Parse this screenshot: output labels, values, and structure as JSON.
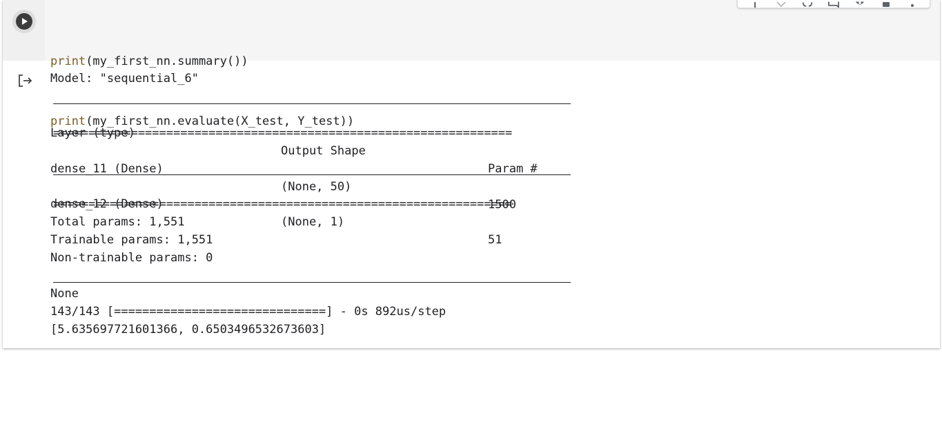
{
  "code": {
    "line1": {
      "fn": "print",
      "rest": "(my_first_nn.summary())"
    },
    "line2": {
      "fn": "print",
      "rest": "(my_first_nn.evaluate(X_test, Y_test))"
    }
  },
  "toolbar": {
    "icons": [
      "arrow-up-icon",
      "arrow-down-icon",
      "link-icon",
      "comment-icon",
      "settings-icon",
      "delete-icon",
      "more-icon"
    ]
  },
  "output": {
    "model_line": "Model: \"sequential_6\"",
    "headers": {
      "layer": "Layer (type)",
      "shape": "Output Shape",
      "params": "Param #"
    },
    "double_rule": "=================================================================",
    "rows": [
      {
        "layer": "dense_11 (Dense)",
        "shape": "(None, 50)",
        "params": "1500"
      },
      {
        "layer": "dense_12 (Dense)",
        "shape": "(None, 1)",
        "params": "51"
      }
    ],
    "total_params": "Total params: 1,551",
    "trainable_params": "Trainable params: 1,551",
    "non_trainable_params": "Non-trainable params: 0",
    "none_line": "None",
    "progress_line": "143/143 [==============================] - 0s 892us/step",
    "result_line": "[5.635697721601366, 0.6503496532673603]"
  },
  "colors": {
    "keyword": "#795e26",
    "code_bg": "#f5f5f5",
    "text": "#202124"
  }
}
